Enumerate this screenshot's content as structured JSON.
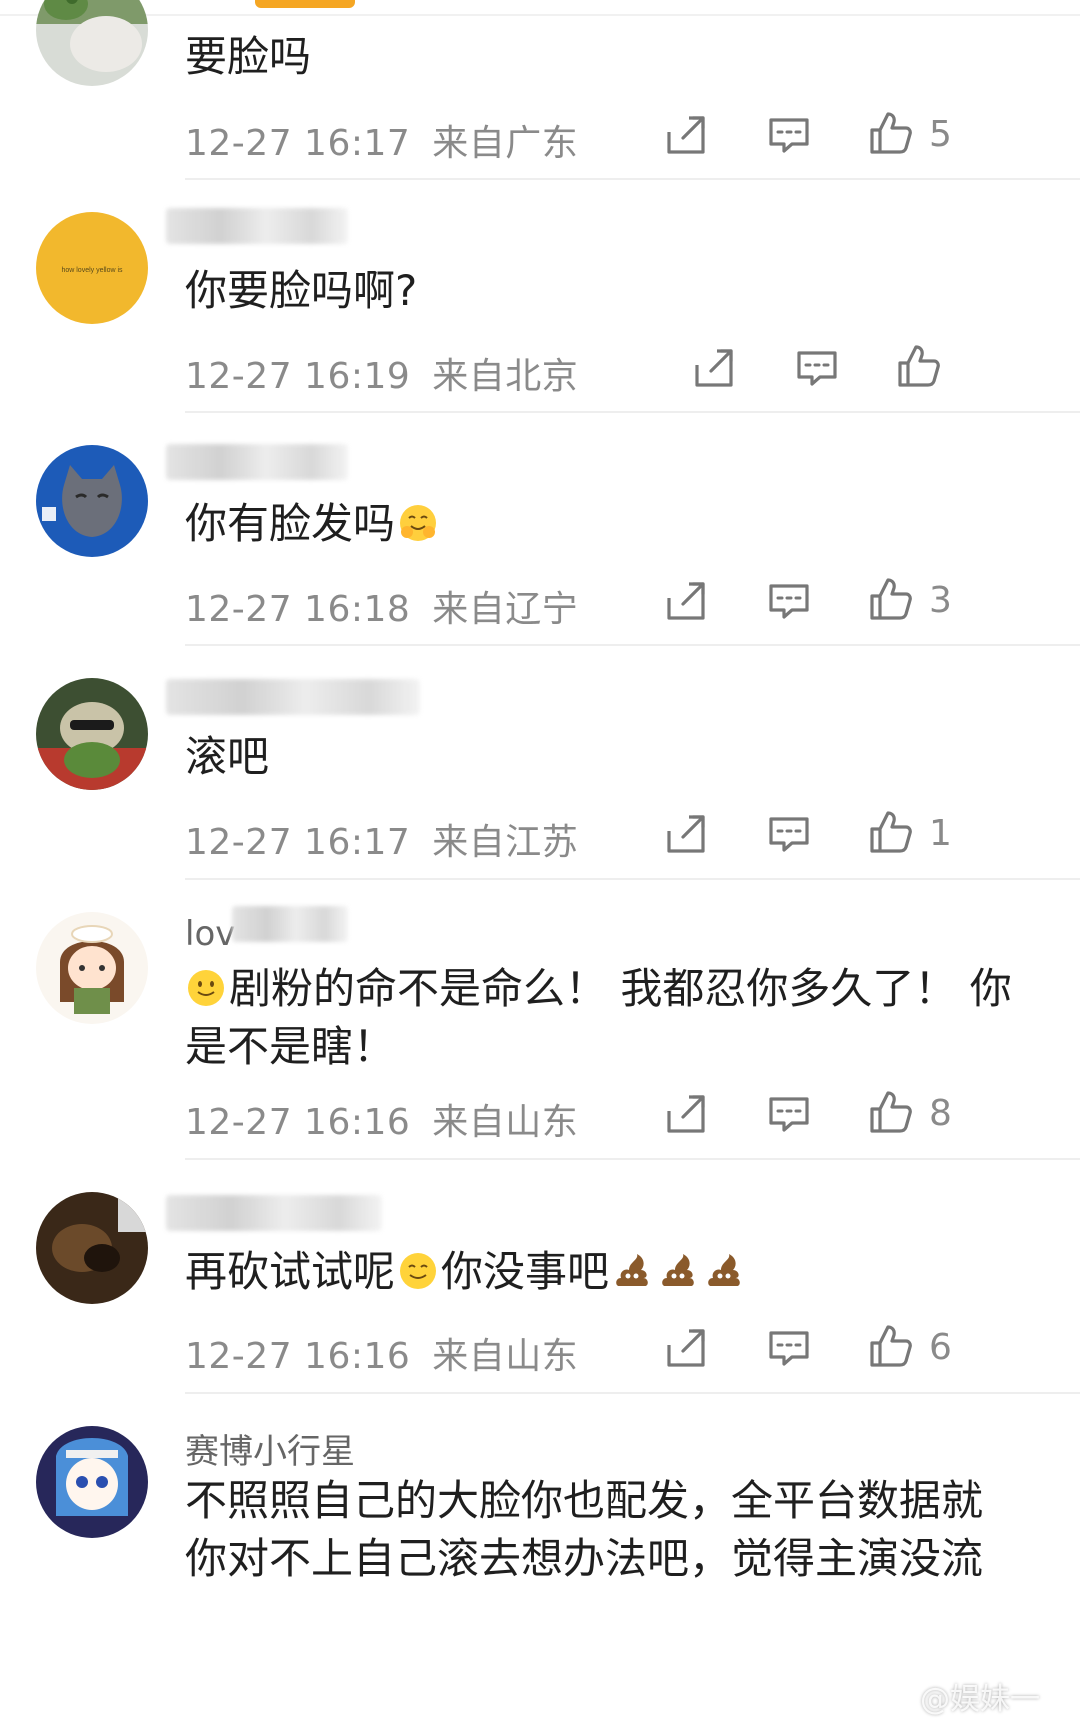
{
  "comments": [
    {
      "username": "",
      "content": "要脸吗",
      "time": "12-27 16:17",
      "location": "来自广东",
      "likes": "5",
      "avatar_icon": "clover-plant-avatar-icon"
    },
    {
      "username": "",
      "content": "你要脸吗啊?",
      "time": "12-27 16:19",
      "location": "来自北京",
      "likes": "",
      "avatar_icon": "yellow-circle-avatar-icon",
      "avatar_text": "how lovely yellow is"
    },
    {
      "username": "",
      "content": "你有脸发吗",
      "time": "12-27 16:18",
      "location": "来自辽宁",
      "likes": "3",
      "avatar_icon": "gray-cat-avatar-icon"
    },
    {
      "username": "",
      "content": "滚吧",
      "time": "12-27 16:17",
      "location": "来自江苏",
      "likes": "1",
      "avatar_icon": "plush-toy-avatar-icon"
    },
    {
      "username": "lov",
      "content_line1": "剧粉的命不是命么！ 我都忍你多久了！ 你",
      "content_line2": "是不是瞎！",
      "time": "12-27 16:16",
      "location": "来自山东",
      "likes": "8",
      "avatar_icon": "cartoon-girl-avatar-icon"
    },
    {
      "username": "",
      "content_a": "再砍试试呢",
      "content_b": "你没事吧",
      "time": "12-27 16:16",
      "location": "来自山东",
      "likes": "6",
      "avatar_icon": "dark-photo-avatar-icon"
    },
    {
      "username": "赛博小行星",
      "content_line1": "不照照自己的大脸你也配发，全平台数据就",
      "content_line2": "你对不上自己滚去想办法吧，觉得主演没流",
      "avatar_icon": "anime-character-avatar-icon"
    }
  ],
  "watermark": "@娱妹一",
  "colors": {
    "accent": "#f5a623",
    "meta_text": "#8a8a8a",
    "body_text": "#1f1f1f"
  }
}
